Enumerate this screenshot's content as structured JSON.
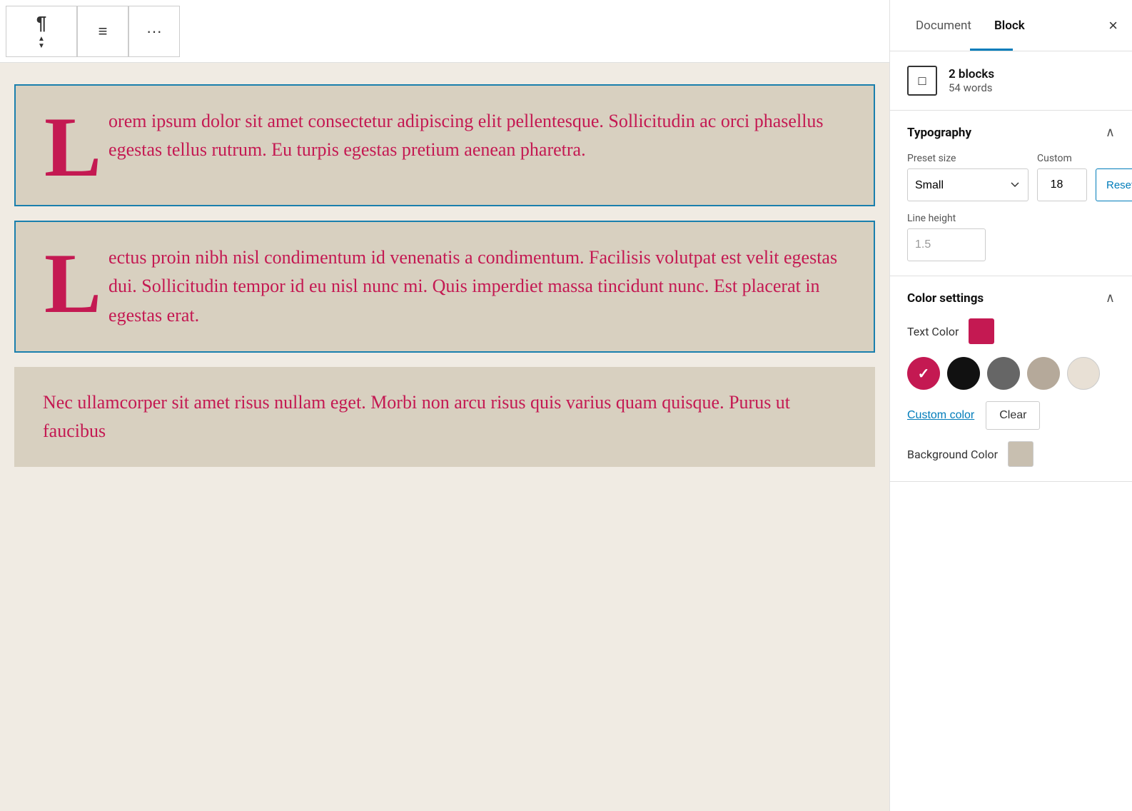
{
  "toolbar": {
    "paragraph_icon": "¶",
    "arrow_up": "▲",
    "arrow_down": "▼",
    "list_icon": "≡",
    "more_icon": "···"
  },
  "blocks": [
    {
      "drop_cap": "L",
      "text": "orem ipsum dolor sit amet consectetur adipiscing elit pellentesque. Sollicitudin ac orci phasellus egestas tellus rutrum. Eu turpis egestas pretium aenean pharetra."
    },
    {
      "drop_cap": "L",
      "text": "ectus proin nibh nisl condimentum id venenatis a condimentum. Facilisis volutpat est velit egestas dui. Sollicitudin tempor id eu nisl nunc mi. Quis imperdiet massa tincidunt nunc. Est placerat in egestas erat."
    },
    {
      "text": "Nec ullamcorper sit amet risus nullam eget. Morbi non arcu risus quis varius quam quisque. Purus ut faucibus"
    }
  ],
  "sidebar": {
    "tab_document": "Document",
    "tab_block": "Block",
    "close_label": "×",
    "block_icon": "□",
    "blocks_count": "2 blocks",
    "words_count": "54 words",
    "typography_title": "Typography",
    "preset_label": "Preset size",
    "custom_label": "Custom",
    "preset_value": "Small",
    "custom_value": "18",
    "reset_label": "Reset",
    "line_height_label": "Line height",
    "line_height_value": "1.5",
    "color_settings_title": "Color settings",
    "text_color_label": "Text Color",
    "text_color_hex": "#c41952",
    "swatches": [
      {
        "color": "#c41952",
        "selected": true,
        "name": "red"
      },
      {
        "color": "#111111",
        "selected": false,
        "name": "black"
      },
      {
        "color": "#666666",
        "selected": false,
        "name": "dark-gray"
      },
      {
        "color": "#b5a99a",
        "selected": false,
        "name": "light-tan"
      },
      {
        "color": "#e8e0d5",
        "selected": false,
        "name": "cream"
      }
    ],
    "custom_color_label": "Custom color",
    "clear_label": "Clear",
    "bg_color_label": "Background Color"
  }
}
